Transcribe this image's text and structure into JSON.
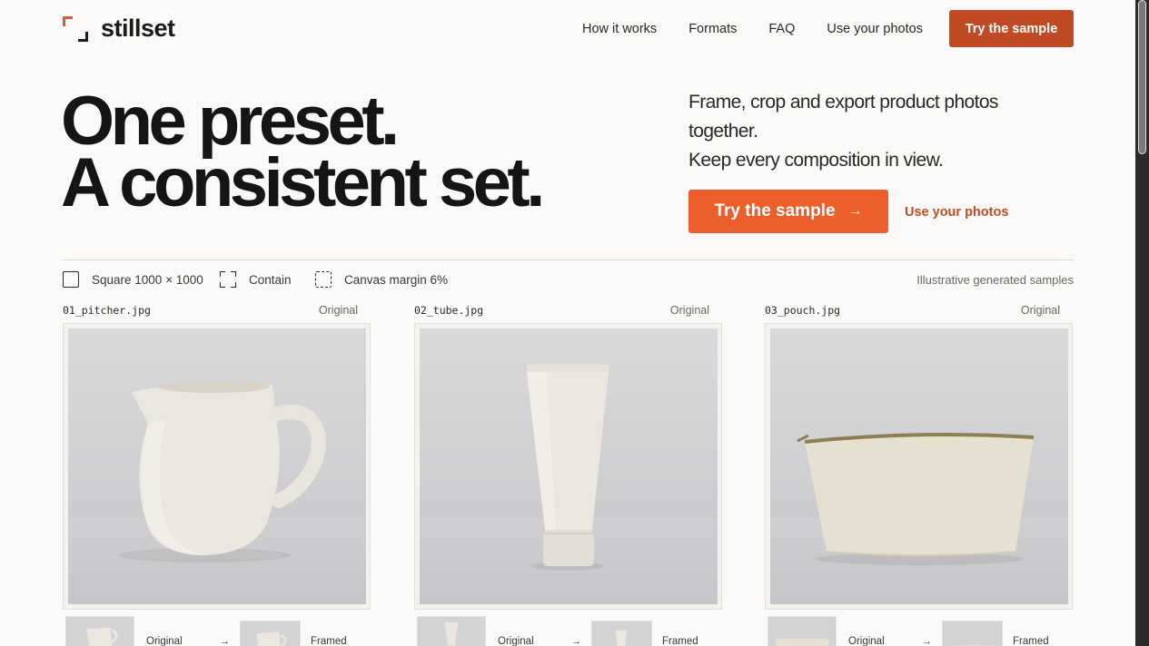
{
  "brand": {
    "name": "stillset",
    "accent": "#ec5f2d",
    "accent_dark": "#bf4a24"
  },
  "nav": {
    "links": [
      "How it works",
      "Formats",
      "FAQ",
      "Use your photos"
    ],
    "cta": "Try the sample"
  },
  "hero": {
    "title_line1": "One preset.",
    "title_line2": "A consistent set.",
    "subtitle_line1": "Frame, crop and export product photos together.",
    "subtitle_line2": "Keep every composition in view.",
    "cta_label": "Try the sample",
    "cta_icon": "arrow-right-icon",
    "secondary_link": "Use your photos"
  },
  "presets": {
    "items": [
      {
        "label": "Square 1000 × 1000",
        "icon": "square-icon"
      },
      {
        "label": "Contain",
        "icon": "contain-icon"
      },
      {
        "label": "Canvas margin 6%",
        "icon": "canvas-margin-icon"
      }
    ],
    "note": "Illustrative generated samples"
  },
  "cards": [
    {
      "filename": "01_pitcher.jpg",
      "badge": "Original",
      "thumb_original": "Original",
      "thumb_framed": "Framed"
    },
    {
      "filename": "02_tube.jpg",
      "badge": "Original",
      "thumb_original": "Original",
      "thumb_framed": "Framed"
    },
    {
      "filename": "03_pouch.jpg",
      "badge": "Original",
      "thumb_original": "Original",
      "thumb_framed": "Framed"
    }
  ]
}
